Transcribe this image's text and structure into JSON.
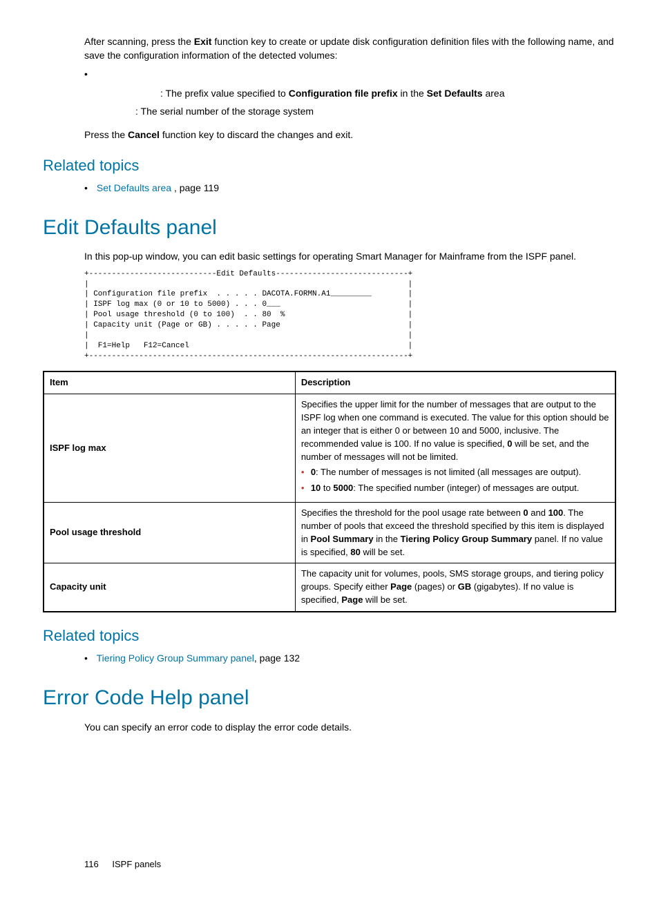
{
  "intro": {
    "p1a": "After scanning, press the ",
    "p1b": "Exit",
    "p1c": " function key to create or update disk configuration definition files with the following name, and save the configuration information of the detected volumes:",
    "line2a": ": The prefix value specified to ",
    "line2b": "Configuration file prefix",
    "line2c": " in the ",
    "line2d": "Set Defaults",
    "line2e": " area",
    "line3": ": The serial number of the storage system",
    "p2a": "Press the ",
    "p2b": "Cancel",
    "p2c": " function key to discard the changes and exit."
  },
  "related1": {
    "heading": "Related topics",
    "link": "Set Defaults area ",
    "suffix": ", page 119"
  },
  "editdefaults": {
    "heading": "Edit Defaults panel",
    "intro": "In this pop-up window, you can edit basic settings for operating Smart Manager for Mainframe from the ISPF panel.",
    "mono": "+----------------------------Edit Defaults-----------------------------+\n|                                                                      |\n| Configuration file prefix  . . . . . DACOTA.FORMN.A1_________        |\n| ISPF log max (0 or 10 to 5000) . . . 0___                            |\n| Pool usage threshold (0 to 100)  . . 80  %                           |\n| Capacity unit (Page or GB) . . . . . Page                            |\n|                                                                      |\n|  F1=Help   F12=Cancel                                                |\n+----------------------------------------------------------------------+"
  },
  "table": {
    "h1": "Item",
    "h2": "Description",
    "r1": {
      "item": "ISPF log max",
      "desc_a": "Specifies the upper limit for the number of messages that are output to the ISPF log when one command is executed. The value for this option should be an integer that is either 0 or between 10 and 5000, inclusive. The recommended value is 100. If no value is specified, ",
      "desc_b": "0",
      "desc_c": " will be set, and the number of messages will not be limited.",
      "b1a": "0",
      "b1b": ": The number of messages is not limited (all messages are output).",
      "b2a": "10",
      "b2b": " to ",
      "b2c": "5000",
      "b2d": ": The specified number (integer) of messages are output."
    },
    "r2": {
      "item": "Pool usage threshold",
      "d1": "Specifies the threshold for the pool usage rate between ",
      "d2": "0",
      "d3": " and ",
      "d4": "100",
      "d5": ". The number of pools that exceed the threshold specified by this item is displayed in ",
      "d6": "Pool Summary",
      "d7": " in the ",
      "d8": "Tiering Policy Group Summary",
      "d9": " panel. If no value is specified, ",
      "d10": "80",
      "d11": " will be set."
    },
    "r3": {
      "item": "Capacity unit",
      "d1": "The capacity unit for volumes, pools, SMS storage groups, and tiering policy groups. Specify either ",
      "d2": "Page",
      "d3": " (pages) or ",
      "d4": "GB",
      "d5": " (gigabytes). If no value is specified, ",
      "d6": "Page",
      "d7": " will be set."
    }
  },
  "related2": {
    "heading": "Related topics",
    "link": "Tiering Policy Group Summary panel",
    "suffix": ", page 132"
  },
  "errorcode": {
    "heading": "Error Code Help panel",
    "intro": "You can specify an error code to display the error code details."
  },
  "footer": {
    "page": "116",
    "label": "ISPF panels"
  }
}
